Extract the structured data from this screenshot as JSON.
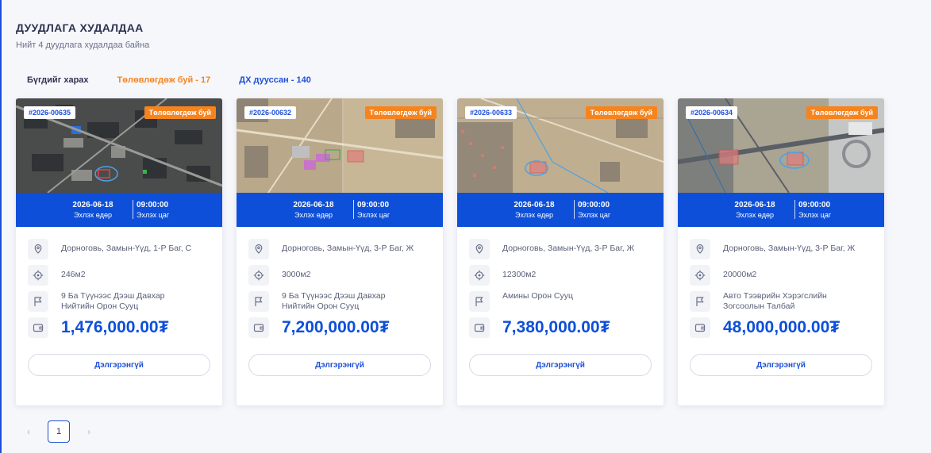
{
  "page": {
    "title": "ДУУДЛАГА ХУДАЛДАА",
    "subtitle": "Нийт 4 дуудлага худалдаа байна"
  },
  "tabs": [
    {
      "label": "Бүгдийг харах"
    },
    {
      "label": "Төлөвлөгдөж буй - 17"
    },
    {
      "label": "ДХ дууссан - 140"
    }
  ],
  "colors": {
    "accent": "#0d4fd9",
    "status": "#f5841f",
    "price": "#0d4fd9"
  },
  "icons": {
    "location": "map-pin-icon",
    "area": "target-icon",
    "purpose": "flag-icon",
    "price": "wallet-icon"
  },
  "cards": [
    {
      "lot": "#2026-00635",
      "status": "Төлөвлөгдөж буй",
      "start_date": "2026-06-18",
      "start_date_label": "Эхлэх өдөр",
      "start_time": "09:00:00",
      "start_time_label": "Эхлэх цаг",
      "location": "Дорноговь, Замын-Үүд, 1-Р Баг, С",
      "area": "246м2",
      "purpose": "9 Ба Түүнээс Дээш Давхар Нийтийн Орон Сууц",
      "price": "1,476,000.00₮",
      "button": "Дэлгэрэнгүй"
    },
    {
      "lot": "#2026-00632",
      "status": "Төлөвлөгдөж буй",
      "start_date": "2026-06-18",
      "start_date_label": "Эхлэх өдөр",
      "start_time": "09:00:00",
      "start_time_label": "Эхлэх цаг",
      "location": "Дорноговь, Замын-Үүд, 3-Р Баг, Ж",
      "area": "3000м2",
      "purpose": "9 Ба Түүнээс Дээш Давхар Нийтийн Орон Сууц",
      "price": "7,200,000.00₮",
      "button": "Дэлгэрэнгүй"
    },
    {
      "lot": "#2026-00633",
      "status": "Төлөвлөгдөж буй",
      "start_date": "2026-06-18",
      "start_date_label": "Эхлэх өдөр",
      "start_time": "09:00:00",
      "start_time_label": "Эхлэх цаг",
      "location": "Дорноговь, Замын-Үүд, 3-Р Баг, Ж",
      "area": "12300м2",
      "purpose": "Амины Орон Сууц",
      "price": "7,380,000.00₮",
      "button": "Дэлгэрэнгүй"
    },
    {
      "lot": "#2026-00634",
      "status": "Төлөвлөгдөж буй",
      "start_date": "2026-06-18",
      "start_date_label": "Эхлэх өдөр",
      "start_time": "09:00:00",
      "start_time_label": "Эхлэх цаг",
      "location": "Дорноговь, Замын-Үүд, 3-Р Баг, Ж",
      "area": "20000м2",
      "purpose": "Авто Тээврийн Хэрэгслийн Зогсоолын Талбай",
      "price": "48,000,000.00₮",
      "button": "Дэлгэрэнгүй"
    }
  ],
  "pagination": {
    "prev": "‹",
    "current": "1",
    "next": "›"
  }
}
